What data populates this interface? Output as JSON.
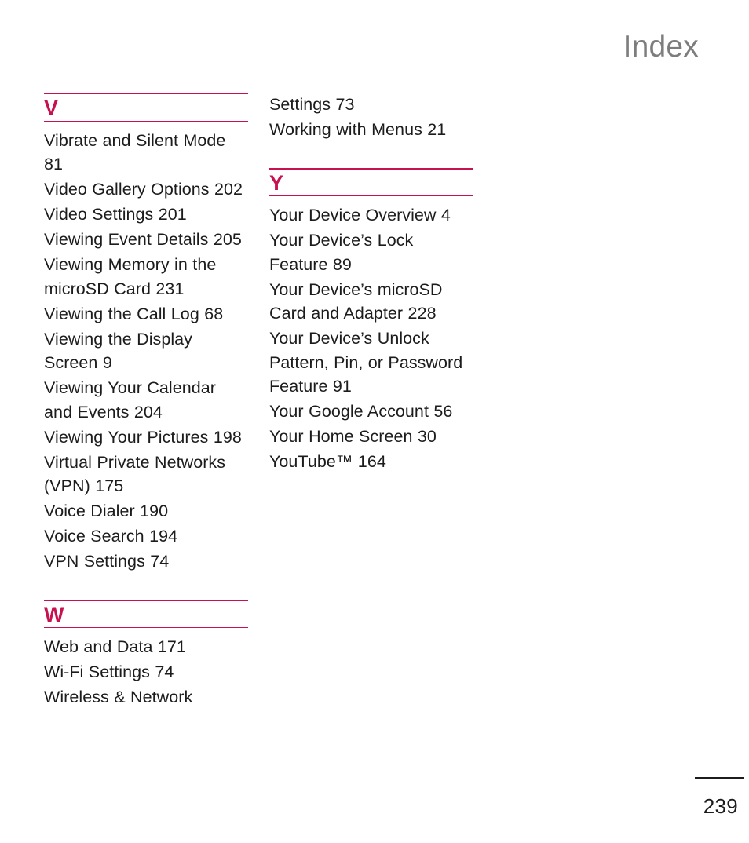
{
  "header": {
    "title": "Index"
  },
  "columns": [
    {
      "name": "left-column",
      "sections": [
        {
          "letter": "V",
          "continued": false,
          "entries": [
            "Vibrate and Silent Mode 81",
            "Video Gallery Options 202",
            "Video Settings 201",
            "Viewing Event Details 205",
            "Viewing Memory in the microSD Card 231",
            "Viewing the Call Log 68",
            "Viewing the Display Screen 9",
            "Viewing Your Calendar and Events 204",
            "Viewing Your Pictures 198",
            "Virtual Private Networks (VPN) 175",
            "Voice Dialer 190",
            "Voice Search 194",
            "VPN Settings 74"
          ]
        },
        {
          "letter": "W",
          "continued": false,
          "entries": [
            "Web and Data 171",
            "Wi-Fi Settings 74",
            "Wireless & Network"
          ]
        }
      ]
    },
    {
      "name": "right-column",
      "sections": [
        {
          "letter": "",
          "continued": true,
          "entries": [
            "Settings 73",
            "Working with Menus 21"
          ]
        },
        {
          "letter": "Y",
          "continued": false,
          "entries": [
            "Your Device Overview 4",
            "Your Device’s Lock Feature 89",
            "Your Device’s microSD Card and Adapter 228",
            "Your Device’s Unlock Pattern, Pin, or Password Feature 91",
            "Your Google Account 56",
            "Your Home Screen 30",
            "YouTube™ 164"
          ]
        }
      ]
    }
  ],
  "footer": {
    "page_number": "239"
  },
  "colors": {
    "accent": "#c8124e",
    "body_text": "#1c1c1c",
    "running_head": "#7d7d7d",
    "page_background": "#ffffff"
  }
}
